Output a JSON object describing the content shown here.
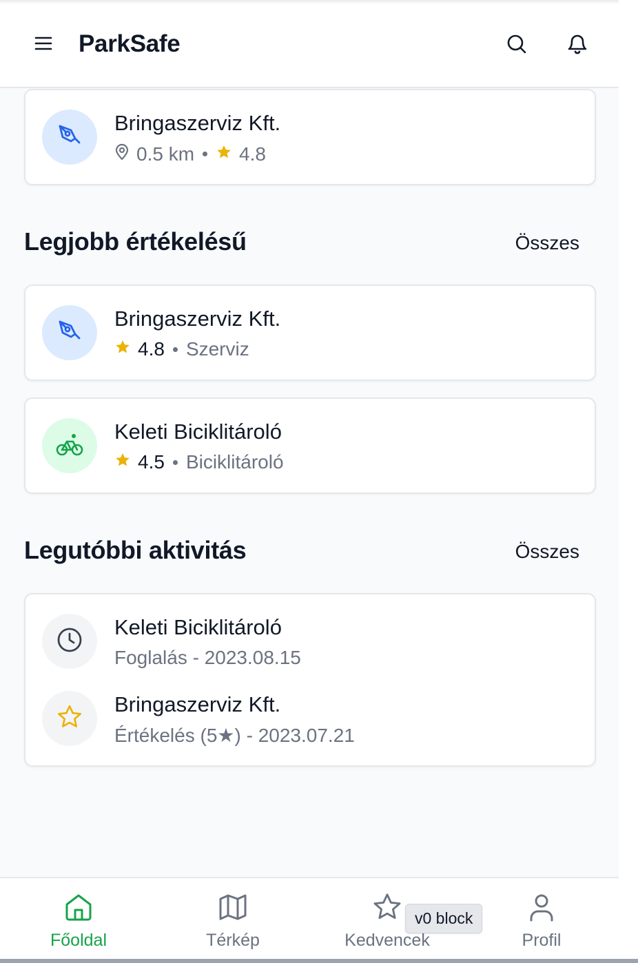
{
  "header": {
    "title": "ParkSafe",
    "menu_icon": "hamburger-icon",
    "search_icon": "search-icon",
    "notification_icon": "bell-icon"
  },
  "nearby_card": {
    "title": "Bringaszerviz Kft.",
    "distance": "0.5 km",
    "rating": "4.8",
    "icon": "wrench-icon"
  },
  "top_rated": {
    "heading": "Legjobb értékelésű",
    "see_all": "Összes",
    "items": [
      {
        "title": "Bringaszerviz Kft.",
        "rating": "4.8",
        "category": "Szerviz",
        "icon": "wrench-icon"
      },
      {
        "title": "Keleti Biciklitároló",
        "rating": "4.5",
        "category": "Biciklitároló",
        "icon": "bike-icon"
      }
    ]
  },
  "recent_activity": {
    "heading": "Legutóbbi aktivitás",
    "see_all": "Összes",
    "items": [
      {
        "title": "Keleti Biciklitároló",
        "detail": "Foglalás - 2023.08.15",
        "icon": "clock-icon"
      },
      {
        "title": "Bringaszerviz Kft.",
        "detail": "Értékelés (5★) - 2023.07.21",
        "icon": "star-outline-icon"
      }
    ]
  },
  "bottom_nav": {
    "items": [
      {
        "label": "Főoldal",
        "icon": "home-icon",
        "active": true
      },
      {
        "label": "Térkép",
        "icon": "map-icon",
        "active": false
      },
      {
        "label": "Kedvencek",
        "icon": "star-outline-icon",
        "active": false
      },
      {
        "label": "Profil",
        "icon": "user-icon",
        "active": false
      }
    ]
  },
  "tooltip": {
    "text": "v0 block"
  },
  "colors": {
    "accent_green": "#16a34a",
    "accent_blue": "#2563eb",
    "star_yellow": "#eab308",
    "muted_text": "#6b7280",
    "avatar_blue_bg": "#dbeafe",
    "avatar_green_bg": "#dcfce7"
  }
}
